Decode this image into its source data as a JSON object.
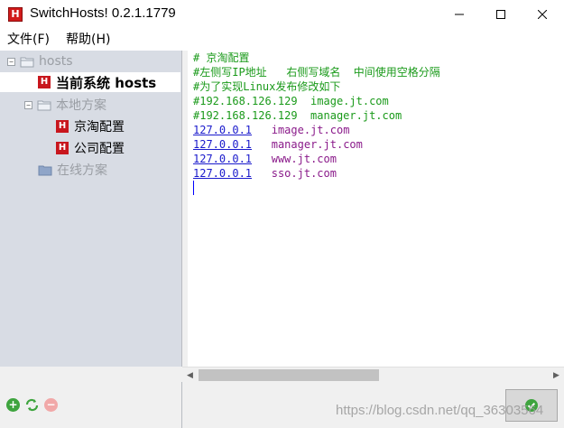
{
  "window": {
    "app_icon_letter": "H",
    "title": "SwitchHosts! 0.2.1.1779"
  },
  "menu": {
    "file": "文件(F)",
    "help": "帮助(H)"
  },
  "sidebar": {
    "root_label": "hosts",
    "current_label": "当前系统 hosts",
    "local_group_label": "本地方案",
    "local_items": [
      "京淘配置",
      "公司配置"
    ],
    "online_group_label": "在线方案",
    "h_letter": "H"
  },
  "editor": {
    "lines": [
      "# 京淘配置",
      "#左侧写IP地址   右侧写域名  中间使用空格分隔",
      "#为了实现Linux发布修改如下",
      "#192.168.126.129  image.jt.com",
      "#192.168.126.129  manager.jt.com"
    ],
    "entries": [
      {
        "ip": "127.0.0.1",
        "host": "image.jt.com"
      },
      {
        "ip": "127.0.0.1",
        "host": "manager.jt.com"
      },
      {
        "ip": "127.0.0.1",
        "host": "www.jt.com"
      },
      {
        "ip": "127.0.0.1",
        "host": "sso.jt.com"
      }
    ]
  },
  "footer": {
    "watermark": "https://blog.csdn.net/qq_36303564"
  },
  "colors": {
    "comment": "#1a9a1a",
    "ip": "#1a1acc",
    "host": "#8a1a8a",
    "sidebar_bg": "#d8dce4",
    "accent_red": "#c8161d"
  }
}
